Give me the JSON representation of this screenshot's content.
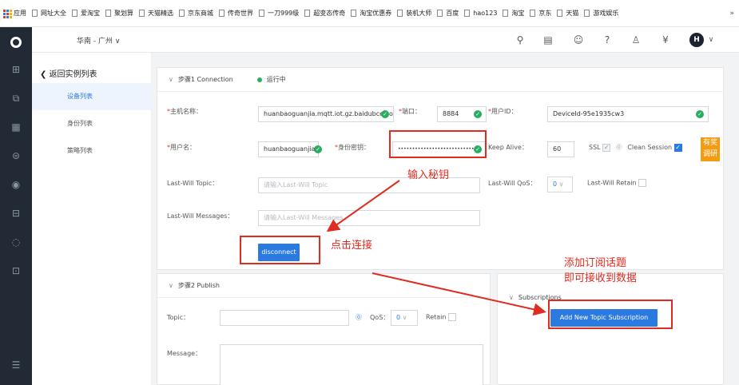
{
  "bookmarks": {
    "apps": "应用",
    "items": [
      "网址大全",
      "爱淘宝",
      "聚划算",
      "天猫精选",
      "京东商城",
      "传奇世界",
      "一刀999级",
      "超变态传奇",
      "淘宝优惠券",
      "装机大师",
      "百度",
      "hao123",
      "淘宝",
      "京东",
      "天猫",
      "游戏娱乐"
    ],
    "more": "»"
  },
  "header": {
    "region": "华南 - 广州 ∨",
    "icons": [
      "search-icon",
      "document-icon",
      "message-icon",
      "help-icon",
      "org-icon",
      "currency-icon"
    ],
    "avatar": "H"
  },
  "subnav": {
    "back": "返回实例列表",
    "items": [
      "设备列表",
      "身份列表",
      "策略列表"
    ],
    "active_index": 0
  },
  "step1": {
    "title": "步骤1  Connection",
    "status": "运行中",
    "host_label": "主机名称：",
    "host_value": "huanbaoguanjia.mqtt.iot.gz.baidubce.com",
    "port_label": "端口：",
    "port_value": "8884",
    "userid_label": "用户ID：",
    "userid_value": "DeviceId-95e1935cw3",
    "username_label": "用户名：",
    "username_value": "huanbaoguanjia/ne",
    "secret_label": "身份密钥：",
    "secret_value": "•••••••••••••••••••••••••••••",
    "keepalive_label": "Keep Alive：",
    "keepalive_value": "60",
    "ssl_label": "SSL",
    "clean_session_label": "Clean Session",
    "will_topic_label": "Last-Will Topic：",
    "will_topic_placeholder": "请输入Last-Will Topic",
    "will_qos_label": "Last-Will QoS：",
    "will_qos_value": "0",
    "will_retain_label": "Last-Will Retain",
    "will_msg_label": "Last-Will Messages：",
    "will_msg_placeholder": "请输入Last-Will Messages",
    "disconnect": "disconnect"
  },
  "step2": {
    "title": "步骤2  Publish",
    "topic_label": "Topic：",
    "qos_label": "QoS：",
    "qos_value": "0",
    "retain_label": "Retain",
    "message_label": "Message："
  },
  "subscriptions": {
    "title": "Subscriptions",
    "add_button": "Add New Topic Subscription"
  },
  "annotations": {
    "input_secret": "输入秘钥",
    "click_connect": "点击连接",
    "add_sub_line1": "添加订阅话题",
    "add_sub_line2": "即可接收到数据"
  },
  "side_tag": "有奖调研",
  "colors": {
    "accent": "#2a7ae2",
    "annotation": "#e02b20",
    "ok": "#27ae60",
    "sidebar": "#222a35"
  }
}
